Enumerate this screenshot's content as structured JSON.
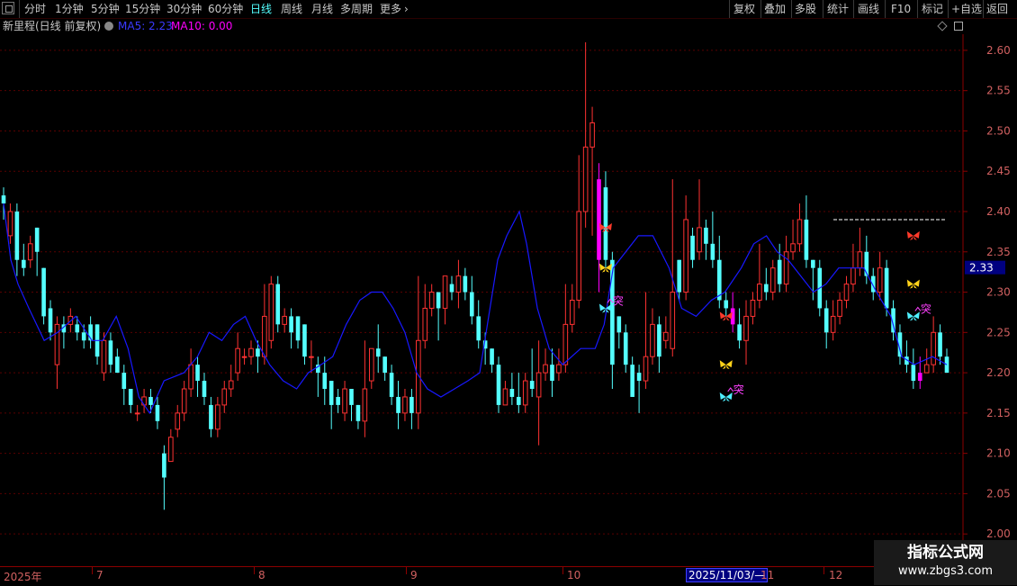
{
  "toolbar": {
    "periods": [
      "分时",
      "1分钟",
      "5分钟",
      "15分钟",
      "30分钟",
      "60分钟",
      "日线",
      "周线",
      "月线",
      "多周期",
      "更多"
    ],
    "active_period": "日线",
    "right_buttons": [
      "复权",
      "叠加",
      "多股",
      "统计",
      "画线",
      "F10",
      "标记",
      "+自选",
      "返回"
    ]
  },
  "info": {
    "stock": "新里程(日线 前复权)",
    "ma5_label": "MA5: 2.23",
    "ma10_label": "MA10: 0.00"
  },
  "colors": {
    "up": "#ff3232",
    "down": "#54ffff",
    "ma5": "#1818ff",
    "ma10": "#ff00ff",
    "grid": "#5a0000",
    "axis": "#8b0000",
    "label": "#d06060"
  },
  "price_flag": "2.33",
  "date_flag": "2025/11/03/—",
  "x_axis_labels": [
    "2025年",
    "7",
    "8",
    "9",
    "10",
    "11",
    "12"
  ],
  "watermark": {
    "line1": "指标公式网",
    "line2": "www.zbgs3.com"
  },
  "chart_data": {
    "type": "candlestick",
    "ylim": [
      1.96,
      2.62
    ],
    "yticks": [
      2.0,
      2.05,
      2.1,
      2.15,
      2.2,
      2.25,
      2.3,
      2.35,
      2.4,
      2.45,
      2.5,
      2.55,
      2.6
    ],
    "resistance_line": 2.39,
    "candles": [
      [
        2.42,
        2.41,
        2.43,
        2.39
      ],
      [
        2.37,
        2.4,
        2.41,
        2.36
      ],
      [
        2.4,
        2.34,
        2.41,
        2.32
      ],
      [
        2.34,
        2.33,
        2.36,
        2.32
      ],
      [
        2.34,
        2.36,
        2.37,
        2.33
      ],
      [
        2.38,
        2.35,
        2.38,
        2.32
      ],
      [
        2.33,
        2.27,
        2.33,
        2.26
      ],
      [
        2.28,
        2.25,
        2.29,
        2.24
      ],
      [
        2.21,
        2.26,
        2.27,
        2.18
      ],
      [
        2.26,
        2.25,
        2.27,
        2.23
      ],
      [
        2.26,
        2.27,
        2.28,
        2.25
      ],
      [
        2.26,
        2.25,
        2.27,
        2.24
      ],
      [
        2.25,
        2.24,
        2.26,
        2.23
      ],
      [
        2.26,
        2.24,
        2.27,
        2.23
      ],
      [
        2.26,
        2.22,
        2.26,
        2.21
      ],
      [
        2.2,
        2.24,
        2.25,
        2.19
      ],
      [
        2.24,
        2.21,
        2.25,
        2.2
      ],
      [
        2.22,
        2.2,
        2.23,
        2.2
      ],
      [
        2.2,
        2.18,
        2.21,
        2.16
      ],
      [
        2.18,
        2.16,
        2.18,
        2.15
      ],
      [
        2.15,
        2.15,
        2.16,
        2.14
      ],
      [
        2.16,
        2.17,
        2.18,
        2.15
      ],
      [
        2.17,
        2.16,
        2.18,
        2.15
      ],
      [
        2.16,
        2.14,
        2.17,
        2.13
      ],
      [
        2.1,
        2.07,
        2.11,
        2.03
      ],
      [
        2.09,
        2.12,
        2.13,
        2.09
      ],
      [
        2.13,
        2.15,
        2.16,
        2.12
      ],
      [
        2.15,
        2.18,
        2.19,
        2.14
      ],
      [
        2.18,
        2.21,
        2.23,
        2.17
      ],
      [
        2.21,
        2.19,
        2.22,
        2.17
      ],
      [
        2.19,
        2.17,
        2.2,
        2.16
      ],
      [
        2.16,
        2.13,
        2.17,
        2.12
      ],
      [
        2.13,
        2.16,
        2.17,
        2.12
      ],
      [
        2.16,
        2.18,
        2.19,
        2.15
      ],
      [
        2.18,
        2.19,
        2.21,
        2.17
      ],
      [
        2.2,
        2.23,
        2.25,
        2.19
      ],
      [
        2.22,
        2.22,
        2.23,
        2.21
      ],
      [
        2.22,
        2.23,
        2.24,
        2.21
      ],
      [
        2.23,
        2.22,
        2.24,
        2.2
      ],
      [
        2.22,
        2.27,
        2.31,
        2.21
      ],
      [
        2.24,
        2.31,
        2.32,
        2.23
      ],
      [
        2.31,
        2.26,
        2.32,
        2.25
      ],
      [
        2.26,
        2.27,
        2.28,
        2.25
      ],
      [
        2.27,
        2.25,
        2.28,
        2.23
      ],
      [
        2.27,
        2.24,
        2.27,
        2.23
      ],
      [
        2.26,
        2.22,
        2.26,
        2.21
      ],
      [
        2.22,
        2.22,
        2.24,
        2.2
      ],
      [
        2.21,
        2.2,
        2.22,
        2.17
      ],
      [
        2.2,
        2.18,
        2.22,
        2.16
      ],
      [
        2.19,
        2.16,
        2.19,
        2.13
      ],
      [
        2.17,
        2.16,
        2.18,
        2.15
      ],
      [
        2.15,
        2.18,
        2.19,
        2.14
      ],
      [
        2.18,
        2.16,
        2.18,
        2.14
      ],
      [
        2.16,
        2.14,
        2.16,
        2.13
      ],
      [
        2.14,
        2.18,
        2.24,
        2.12
      ],
      [
        2.19,
        2.23,
        2.23,
        2.18
      ],
      [
        2.23,
        2.22,
        2.26,
        2.2
      ],
      [
        2.22,
        2.2,
        2.22,
        2.19
      ],
      [
        2.2,
        2.17,
        2.21,
        2.16
      ],
      [
        2.17,
        2.15,
        2.19,
        2.13
      ],
      [
        2.15,
        2.17,
        2.18,
        2.14
      ],
      [
        2.17,
        2.15,
        2.18,
        2.13
      ],
      [
        2.15,
        2.24,
        2.32,
        2.13
      ],
      [
        2.24,
        2.28,
        2.31,
        2.23
      ],
      [
        2.28,
        2.3,
        2.31,
        2.27
      ],
      [
        2.3,
        2.28,
        2.3,
        2.24
      ],
      [
        2.28,
        2.32,
        2.32,
        2.26
      ],
      [
        2.31,
        2.3,
        2.32,
        2.29
      ],
      [
        2.3,
        2.32,
        2.34,
        2.28
      ],
      [
        2.32,
        2.3,
        2.33,
        2.29
      ],
      [
        2.3,
        2.27,
        2.32,
        2.26
      ],
      [
        2.27,
        2.24,
        2.29,
        2.23
      ],
      [
        2.24,
        2.23,
        2.25,
        2.21
      ],
      [
        2.23,
        2.21,
        2.23,
        2.2
      ],
      [
        2.21,
        2.16,
        2.22,
        2.15
      ],
      [
        2.16,
        2.18,
        2.19,
        2.16
      ],
      [
        2.18,
        2.17,
        2.2,
        2.16
      ],
      [
        2.17,
        2.16,
        2.2,
        2.15
      ],
      [
        2.16,
        2.19,
        2.2,
        2.15
      ],
      [
        2.19,
        2.18,
        2.23,
        2.17
      ],
      [
        2.17,
        2.2,
        2.24,
        2.11
      ],
      [
        2.2,
        2.21,
        2.23,
        2.19
      ],
      [
        2.21,
        2.19,
        2.23,
        2.17
      ],
      [
        2.2,
        2.21,
        2.23,
        2.19
      ],
      [
        2.21,
        2.26,
        2.31,
        2.2
      ],
      [
        2.26,
        2.29,
        2.31,
        2.25
      ],
      [
        2.29,
        2.4,
        2.47,
        2.28
      ],
      [
        2.4,
        2.48,
        2.61,
        2.38
      ],
      [
        2.48,
        2.51,
        2.53,
        2.37
      ],
      [
        2.44,
        2.34,
        2.46,
        2.3
      ],
      [
        2.43,
        2.34,
        2.45,
        2.33
      ],
      [
        2.34,
        2.21,
        2.35,
        2.18
      ],
      [
        2.27,
        2.25,
        2.27,
        2.23
      ],
      [
        2.25,
        2.21,
        2.26,
        2.2
      ],
      [
        2.21,
        2.17,
        2.22,
        2.17
      ],
      [
        2.2,
        2.19,
        2.21,
        2.15
      ],
      [
        2.19,
        2.22,
        2.3,
        2.18
      ],
      [
        2.22,
        2.26,
        2.28,
        2.21
      ],
      [
        2.26,
        2.22,
        2.27,
        2.2
      ],
      [
        2.24,
        2.25,
        2.27,
        2.23
      ],
      [
        2.23,
        2.3,
        2.44,
        2.22
      ],
      [
        2.34,
        2.3,
        2.34,
        2.29
      ],
      [
        2.3,
        2.39,
        2.42,
        2.29
      ],
      [
        2.37,
        2.34,
        2.38,
        2.33
      ],
      [
        2.35,
        2.38,
        2.44,
        2.34
      ],
      [
        2.38,
        2.36,
        2.39,
        2.34
      ],
      [
        2.36,
        2.34,
        2.4,
        2.33
      ],
      [
        2.34,
        2.29,
        2.37,
        2.28
      ],
      [
        2.29,
        2.28,
        2.3,
        2.27
      ],
      [
        2.28,
        2.26,
        2.3,
        2.25
      ],
      [
        2.26,
        2.24,
        2.28,
        2.23
      ],
      [
        2.24,
        2.27,
        2.29,
        2.21
      ],
      [
        2.27,
        2.29,
        2.3,
        2.26
      ],
      [
        2.29,
        2.31,
        2.36,
        2.28
      ],
      [
        2.31,
        2.3,
        2.33,
        2.29
      ],
      [
        2.3,
        2.33,
        2.34,
        2.29
      ],
      [
        2.34,
        2.31,
        2.36,
        2.3
      ],
      [
        2.31,
        2.35,
        2.37,
        2.3
      ],
      [
        2.35,
        2.36,
        2.39,
        2.34
      ],
      [
        2.36,
        2.39,
        2.41,
        2.35
      ],
      [
        2.39,
        2.34,
        2.42,
        2.33
      ],
      [
        2.34,
        2.33,
        2.34,
        2.29
      ],
      [
        2.33,
        2.28,
        2.34,
        2.27
      ],
      [
        2.28,
        2.25,
        2.29,
        2.23
      ],
      [
        2.25,
        2.27,
        2.29,
        2.24
      ],
      [
        2.27,
        2.29,
        2.3,
        2.26
      ],
      [
        2.29,
        2.31,
        2.32,
        2.28
      ],
      [
        2.31,
        2.33,
        2.36,
        2.3
      ],
      [
        2.33,
        2.35,
        2.38,
        2.32
      ],
      [
        2.35,
        2.32,
        2.37,
        2.31
      ],
      [
        2.32,
        2.3,
        2.33,
        2.29
      ],
      [
        2.3,
        2.33,
        2.35,
        2.29
      ],
      [
        2.33,
        2.28,
        2.34,
        2.27
      ],
      [
        2.28,
        2.25,
        2.29,
        2.24
      ],
      [
        2.25,
        2.22,
        2.26,
        2.21
      ],
      [
        2.22,
        2.21,
        2.24,
        2.2
      ],
      [
        2.21,
        2.19,
        2.23,
        2.18
      ],
      [
        2.19,
        2.2,
        2.22,
        2.18
      ],
      [
        2.2,
        2.21,
        2.23,
        2.2
      ],
      [
        2.21,
        2.25,
        2.27,
        2.2
      ],
      [
        2.25,
        2.22,
        2.26,
        2.21
      ],
      [
        2.22,
        2.2,
        2.23,
        2.2
      ]
    ],
    "ma5": [
      [
        0,
        2.41
      ],
      [
        8,
        2.34
      ],
      [
        16,
        2.31
      ],
      [
        28,
        2.28
      ],
      [
        45,
        2.24
      ],
      [
        60,
        2.25
      ],
      [
        80,
        2.27
      ],
      [
        98,
        2.24
      ],
      [
        110,
        2.24
      ],
      [
        125,
        2.27
      ],
      [
        138,
        2.23
      ],
      [
        150,
        2.17
      ],
      [
        162,
        2.15
      ],
      [
        178,
        2.19
      ],
      [
        200,
        2.2
      ],
      [
        215,
        2.22
      ],
      [
        228,
        2.25
      ],
      [
        242,
        2.24
      ],
      [
        255,
        2.26
      ],
      [
        268,
        2.27
      ],
      [
        280,
        2.24
      ],
      [
        295,
        2.21
      ],
      [
        310,
        2.19
      ],
      [
        325,
        2.18
      ],
      [
        338,
        2.2
      ],
      [
        352,
        2.21
      ],
      [
        365,
        2.22
      ],
      [
        380,
        2.26
      ],
      [
        395,
        2.29
      ],
      [
        408,
        2.3
      ],
      [
        420,
        2.3
      ],
      [
        432,
        2.28
      ],
      [
        445,
        2.25
      ],
      [
        458,
        2.2
      ],
      [
        470,
        2.18
      ],
      [
        485,
        2.17
      ],
      [
        500,
        2.18
      ],
      [
        515,
        2.19
      ],
      [
        528,
        2.2
      ],
      [
        538,
        2.27
      ],
      [
        548,
        2.34
      ],
      [
        558,
        2.37
      ],
      [
        572,
        2.4
      ],
      [
        580,
        2.36
      ],
      [
        592,
        2.28
      ],
      [
        605,
        2.23
      ],
      [
        620,
        2.21
      ],
      [
        640,
        2.23
      ],
      [
        656,
        2.23
      ],
      [
        666,
        2.26
      ],
      [
        676,
        2.33
      ],
      [
        690,
        2.35
      ],
      [
        704,
        2.37
      ],
      [
        720,
        2.37
      ],
      [
        738,
        2.33
      ],
      [
        752,
        2.28
      ],
      [
        768,
        2.27
      ],
      [
        785,
        2.29
      ],
      [
        800,
        2.3
      ],
      [
        818,
        2.33
      ],
      [
        832,
        2.36
      ],
      [
        846,
        2.37
      ],
      [
        858,
        2.35
      ],
      [
        870,
        2.34
      ],
      [
        884,
        2.32
      ],
      [
        898,
        2.3
      ],
      [
        912,
        2.31
      ],
      [
        926,
        2.33
      ],
      [
        940,
        2.33
      ],
      [
        954,
        2.33
      ],
      [
        968,
        2.3
      ],
      [
        984,
        2.27
      ],
      [
        996,
        2.22
      ],
      [
        1010,
        2.21
      ],
      [
        1030,
        2.22
      ],
      [
        1046,
        2.21
      ]
    ],
    "markers": [
      {
        "type": "butterfly",
        "color": "red",
        "idx": 90,
        "y": 2.38
      },
      {
        "type": "butterfly",
        "color": "yellow",
        "idx": 90,
        "y": 2.33
      },
      {
        "type": "butterfly",
        "color": "cyan",
        "idx": 90,
        "y": 2.28
      },
      {
        "type": "text",
        "text": "突",
        "idx": 90,
        "y": 2.28
      },
      {
        "type": "butterfly",
        "color": "red",
        "idx": 108,
        "y": 2.27
      },
      {
        "type": "butterfly",
        "color": "yellow",
        "idx": 108,
        "y": 2.21
      },
      {
        "type": "butterfly",
        "color": "cyan",
        "idx": 108,
        "y": 2.17
      },
      {
        "type": "text",
        "text": "突",
        "idx": 108,
        "y": 2.17
      },
      {
        "type": "butterfly",
        "color": "red",
        "idx": 136,
        "y": 2.37
      },
      {
        "type": "butterfly",
        "color": "yellow",
        "idx": 136,
        "y": 2.31
      },
      {
        "type": "butterfly",
        "color": "cyan",
        "idx": 136,
        "y": 2.27
      },
      {
        "type": "text",
        "text": "突",
        "idx": 136,
        "y": 2.27
      }
    ],
    "highlight_candles": [
      89,
      109,
      137
    ]
  }
}
